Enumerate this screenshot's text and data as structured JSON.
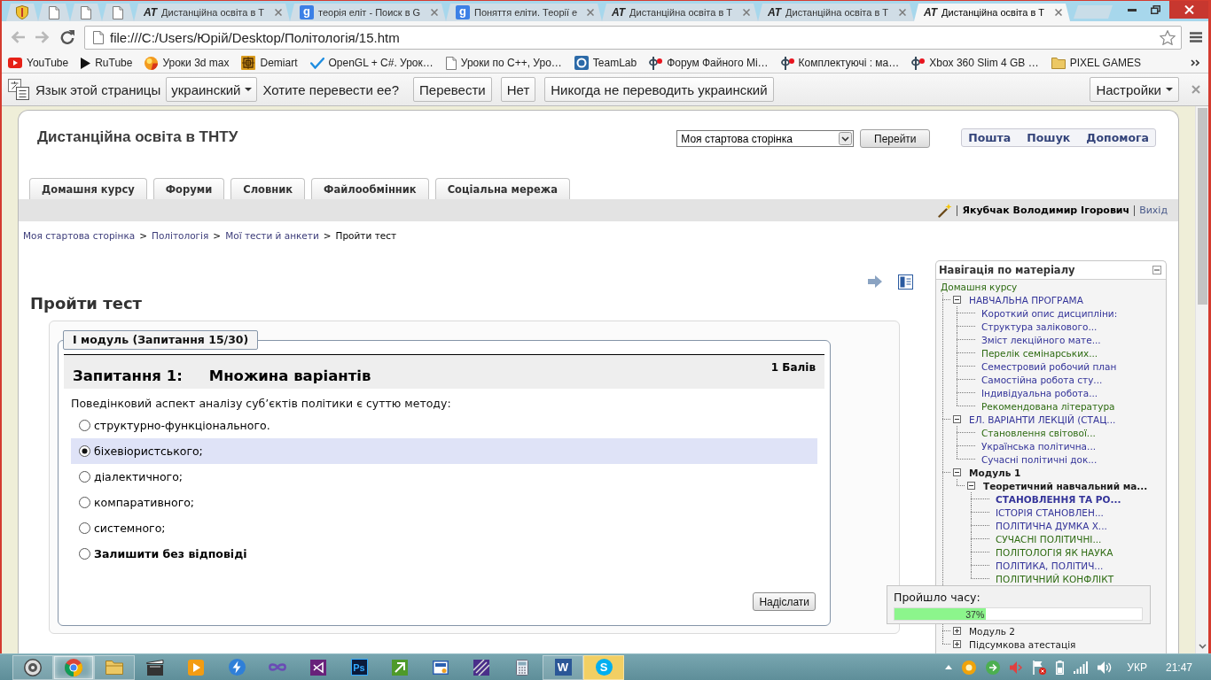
{
  "browser": {
    "tabs": [
      {
        "kind": "shield",
        "selected": false
      },
      {
        "kind": "page",
        "selected": false
      },
      {
        "kind": "page",
        "selected": false
      },
      {
        "kind": "page",
        "selected": false
      },
      {
        "kind": "logo",
        "favicon_text": "AT",
        "title": "Дистанційна освіта в Т",
        "selected": false
      },
      {
        "kind": "search",
        "favicon_text": "g",
        "title": "теорія еліт - Поиск в G",
        "selected": false
      },
      {
        "kind": "search",
        "favicon_text": "g",
        "title": "Поняття еліти. Теорії е",
        "selected": false
      },
      {
        "kind": "logo",
        "favicon_text": "AT",
        "title": "Дистанційна освіта в Т",
        "selected": false
      },
      {
        "kind": "logo",
        "favicon_text": "AT",
        "title": "Дистанційна освіта в Т",
        "selected": false
      },
      {
        "kind": "logo",
        "favicon_text": "AT",
        "title": "Дистанційна освіта в Т",
        "selected": true
      }
    ],
    "nav_buttons": [
      {
        "kind": "back",
        "disabled": true
      },
      {
        "kind": "forward",
        "disabled": true
      },
      {
        "kind": "reload",
        "disabled": false
      }
    ],
    "address": "file:///C:/Users/Юрій/Desktop/Політологія/15.htm",
    "bookmarked": false,
    "bookmarks": [
      {
        "kind": "video",
        "label": "YouTube"
      },
      {
        "kind": "play",
        "label": "RuTube"
      },
      {
        "kind": "sphere",
        "label": "Уроки 3d max"
      },
      {
        "kind": "ornament",
        "label": "Demiart"
      },
      {
        "kind": "check",
        "label": "OpenGL + C#. Урок…"
      },
      {
        "kind": "page",
        "label": "Уроки по C++, Уро…"
      },
      {
        "kind": "ring",
        "label": "TeamLab"
      },
      {
        "kind": "forum",
        "label": "Форум Файного Мі…"
      },
      {
        "kind": "forum",
        "label": "Комплектуючі : ма…"
      },
      {
        "kind": "forum",
        "label": "Xbox 360 Slim 4 GB …"
      },
      {
        "kind": "folder",
        "label": "PIXEL GAMES"
      }
    ],
    "translate_bar": {
      "prompt": "Язык этой страницы",
      "language": "украинский",
      "question": "Хотите перевести ее?",
      "buttons": [
        "Перевести",
        "Нет",
        "Никогда не переводить украинский"
      ],
      "options": "Настройки"
    }
  },
  "site": {
    "title": "Дистанційна освіта в ТНТУ",
    "jump_select": "Моя стартова сторінка",
    "jump_button": "Перейти",
    "links": [
      "Пошта",
      "Пошук",
      "Допомога"
    ],
    "course_tabs": [
      "Домашня курсу",
      "Форуми",
      "Словник",
      "Файлообмінник",
      "Соціальна мережа"
    ],
    "user": "Якубчак Володимир Ігорович",
    "logout": "Вихід",
    "breadcrumb": [
      {
        "kind": "link",
        "text": "Моя стартова сторінка"
      },
      {
        "kind": "separator",
        "text": ">"
      },
      {
        "kind": "link",
        "text": "Політологія"
      },
      {
        "kind": "separator",
        "text": ">"
      },
      {
        "kind": "link",
        "text": "Мої тести й анкети"
      },
      {
        "kind": "separator",
        "text": ">"
      },
      {
        "kind": "current",
        "text": "Пройти тест"
      }
    ],
    "heading": "Пройти тест"
  },
  "quiz": {
    "legend": "І модуль (Запитання 15/30)",
    "number": "Запитання 1:",
    "type": "Множина варіантів",
    "marks": "1 Балів",
    "prompt": "Поведінковий аспект аналізу суб’єктів політики є суттю методу:",
    "options": [
      {
        "kind": "answer",
        "label": "структурно-функціонального.",
        "selected": false
      },
      {
        "kind": "answer",
        "label": "біхевіористського;",
        "selected": true
      },
      {
        "kind": "answer",
        "label": "діалектичного;",
        "selected": false
      },
      {
        "kind": "answer",
        "label": "компаративного;",
        "selected": false
      },
      {
        "kind": "answer",
        "label": "системного;",
        "selected": false
      },
      {
        "kind": "no-answer",
        "label": "Залишити без відповіді",
        "selected": false
      }
    ],
    "submit": "Надіслати"
  },
  "navigation": {
    "title": "Навігація по матеріалу",
    "expanded": true,
    "tree": [
      {
        "label": "Домашня курсу",
        "kind": "link",
        "visited": true,
        "active": false,
        "children": [
          {
            "label": "НАВЧАЛЬНА ПРОГРАМА",
            "kind": "link",
            "visited": false,
            "active": false,
            "expanded": true,
            "children": [
              {
                "label": "Короткий опис дисципліни:",
                "kind": "link",
                "visited": false,
                "active": false
              },
              {
                "label": "Структура залікового...",
                "kind": "link",
                "visited": false,
                "active": false
              },
              {
                "label": "Зміст лекційного мате...",
                "kind": "link",
                "visited": false,
                "active": false
              },
              {
                "label": "Перелік семінарських...",
                "kind": "link",
                "visited": true,
                "active": false
              },
              {
                "label": "Семестровий робочий план",
                "kind": "link",
                "visited": false,
                "active": false
              },
              {
                "label": "Самостійна робота сту...",
                "kind": "link",
                "visited": false,
                "active": false
              },
              {
                "label": "Індивідуальна робота...",
                "kind": "link",
                "visited": false,
                "active": false
              },
              {
                "label": "Рекомендована література",
                "kind": "link",
                "visited": true,
                "active": false
              }
            ]
          },
          {
            "label": "ЕЛ. ВАРІАНТИ ЛЕКЦІЙ (СТАЦ...",
            "kind": "link",
            "visited": false,
            "active": false,
            "expanded": true,
            "children": [
              {
                "label": "Становлення світової...",
                "kind": "link",
                "visited": true,
                "active": false
              },
              {
                "label": "Українська політична...",
                "kind": "link",
                "visited": false,
                "active": false
              },
              {
                "label": "Сучасні політичні док...",
                "kind": "link",
                "visited": false,
                "active": false
              }
            ]
          },
          {
            "label": "Модуль 1",
            "kind": "section",
            "active": true,
            "expanded": true,
            "children": [
              {
                "label": "Теоретичний навчальний ма...",
                "kind": "section",
                "active": true,
                "expanded": true,
                "children": [
                  {
                    "label": "СТАНОВЛЕННЯ ТА РО...",
                    "kind": "link",
                    "visited": false,
                    "active": true
                  },
                  {
                    "label": "ІСТОРІЯ СТАНОВЛЕН...",
                    "kind": "link",
                    "visited": false,
                    "active": false
                  },
                  {
                    "label": "ПОЛІТИЧНА ДУМКА Х...",
                    "kind": "link",
                    "visited": false,
                    "active": false
                  },
                  {
                    "label": "СУЧАСНІ ПОЛІТИЧНІ...",
                    "kind": "link",
                    "visited": true,
                    "active": false
                  },
                  {
                    "label": "ПОЛІТОЛОГІЯ ЯК НАУКА",
                    "kind": "link",
                    "visited": true,
                    "active": false
                  },
                  {
                    "label": "ПОЛІТИКА, ПОЛІТИЧ...",
                    "kind": "link",
                    "visited": false,
                    "active": false
                  },
                  {
                    "label": "ПОЛІТИЧНИЙ КОНФЛІКТ",
                    "kind": "link",
                    "visited": true,
                    "active": false
                  }
                ]
              }
            ]
          },
          {
            "label": "Модуль 2",
            "kind": "section",
            "active": false,
            "expanded": false
          },
          {
            "label": "Підсумкова атестація",
            "kind": "section",
            "active": false,
            "expanded": false
          }
        ]
      }
    ]
  },
  "timer": {
    "label": "Пройшло часу:",
    "level": 0.37,
    "reading": "37%"
  },
  "taskbar": {
    "apps": [
      {
        "kind": "lens",
        "open": true,
        "selected": false,
        "flashing": false
      },
      {
        "kind": "browser",
        "open": true,
        "selected": true,
        "flashing": false
      },
      {
        "kind": "folder",
        "open": true,
        "selected": false,
        "flashing": false
      },
      {
        "kind": "clapper",
        "open": false,
        "selected": false,
        "flashing": false
      },
      {
        "kind": "player",
        "open": false,
        "selected": false,
        "flashing": false
      },
      {
        "kind": "bolt",
        "open": false,
        "selected": false,
        "flashing": false
      },
      {
        "kind": "infinity",
        "open": false,
        "selected": false,
        "flashing": false
      },
      {
        "kind": "ribbon",
        "open": false,
        "selected": false,
        "flashing": false
      },
      {
        "kind": "dark-tile",
        "glyph": "Ps",
        "open": false,
        "selected": false,
        "flashing": false
      },
      {
        "kind": "arrow-tile",
        "open": false,
        "selected": false,
        "flashing": false
      },
      {
        "kind": "window-tile",
        "open": false,
        "selected": false,
        "flashing": false
      },
      {
        "kind": "striped-tile",
        "open": false,
        "selected": false,
        "flashing": false
      },
      {
        "kind": "calculator",
        "open": false,
        "selected": false,
        "flashing": false
      },
      {
        "kind": "doc-tile",
        "glyph": "W",
        "open": true,
        "selected": false,
        "flashing": false
      },
      {
        "kind": "bubble",
        "glyph": "S",
        "open": true,
        "selected": false,
        "flashing": true
      }
    ],
    "language": "УКР",
    "clock": "21:47"
  }
}
